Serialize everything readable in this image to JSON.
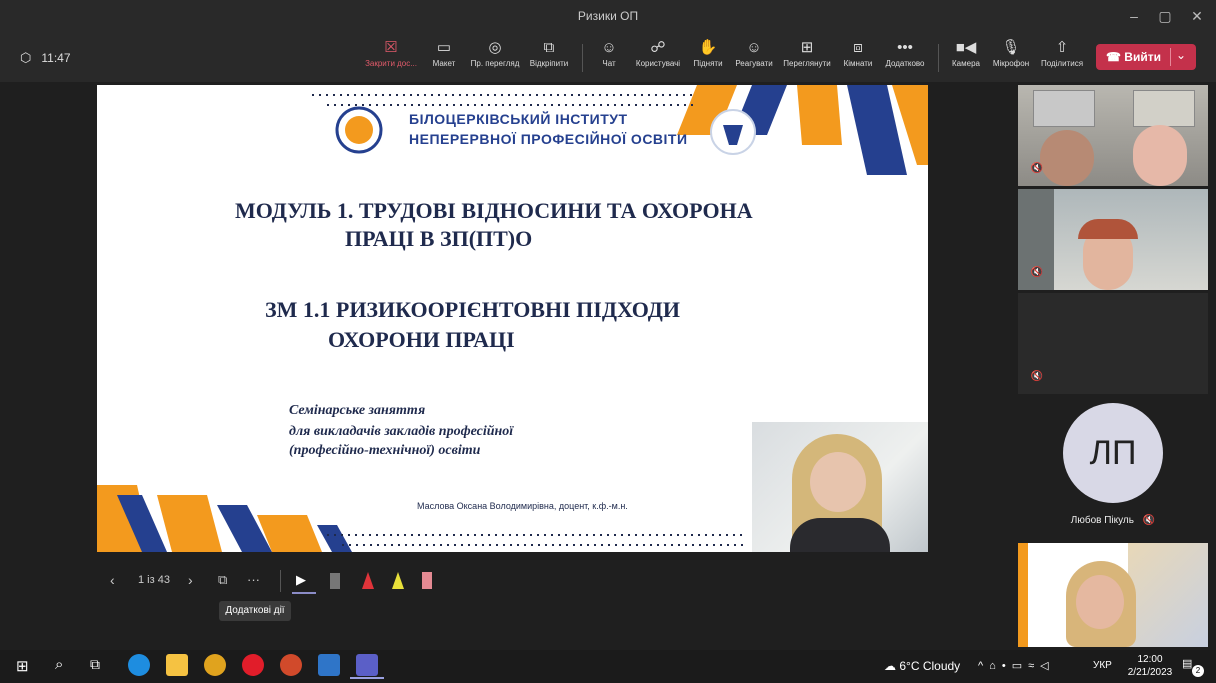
{
  "window": {
    "title": "Ризики ОП",
    "minimize_icon": "minimize-icon",
    "maximize_icon": "maximize-icon",
    "close_icon": "close-icon"
  },
  "meeting": {
    "elapsed": "11:47"
  },
  "toolbar": {
    "stop_share": "Закрити дос...",
    "layout": "Макет",
    "presenter_view": "Пр. перегляд",
    "unpin": "Відкріпити",
    "chat": "Чат",
    "people": "Користувачі",
    "raise": "Підняти",
    "react": "Реагувати",
    "view": "Переглянути",
    "rooms": "Кімнати",
    "more": "Додатково",
    "camera": "Камера",
    "mic": "Мікрофон",
    "share": "Поділитися",
    "leave": "Вийти"
  },
  "slide": {
    "institute_line1": "БІЛОЦЕРКІВСЬКИЙ ІНСТИТУТ",
    "institute_line2": "НЕПЕРЕРВНОЇ ПРОФЕСІЙНОЇ ОСВІТИ",
    "heading1_line1": "МОДУЛЬ 1. ТРУДОВІ ВІДНОСИНИ ТА ОХОРОНА",
    "heading1_line2": "ПРАЦІ В ЗП(ПТ)О",
    "heading2_line1": "ЗМ 1.1  РИЗИКООРІЄНТОВНІ ПІДХОДИ",
    "heading2_line2": "ОХОРОНИ ПРАЦІ",
    "seminar_line1": "Семінарське заняття",
    "seminar_line2": "для викладачів закладів професійної",
    "seminar_line3": "(професійно-технічної) освіти",
    "author": "Маслова Оксана Володимирівна, доцент, к.ф.-м.н."
  },
  "slide_controls": {
    "page": "1 із 43",
    "tooltip": "Додаткові дії",
    "more_label": "···"
  },
  "participants": {
    "initials": "ЛП",
    "name": "Любов Пікуль"
  },
  "taskbar": {
    "weather": "6°C  Cloudy",
    "lang": "УКР",
    "time": "12:00",
    "date": "2/21/2023",
    "notif_count": "2"
  },
  "colors": {
    "leave": "#c4314b",
    "slide_navy": "#1f2a4d",
    "accent_orange": "#f39a1e",
    "accent_blue": "#25408f"
  }
}
